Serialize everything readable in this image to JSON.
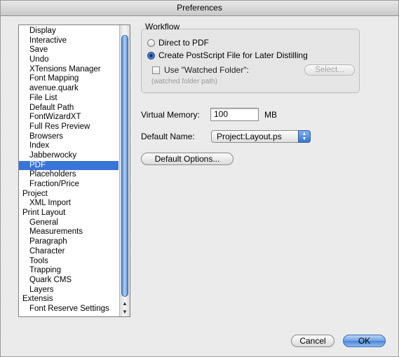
{
  "window": {
    "title": "Preferences"
  },
  "sidebar": {
    "items": [
      {
        "label": "Display",
        "level": 1,
        "selected": false
      },
      {
        "label": "Interactive",
        "level": 1,
        "selected": false
      },
      {
        "label": "Save",
        "level": 1,
        "selected": false
      },
      {
        "label": "Undo",
        "level": 1,
        "selected": false
      },
      {
        "label": "XTensions Manager",
        "level": 1,
        "selected": false
      },
      {
        "label": "Font Mapping",
        "level": 1,
        "selected": false
      },
      {
        "label": "avenue.quark",
        "level": 1,
        "selected": false
      },
      {
        "label": "File List",
        "level": 1,
        "selected": false
      },
      {
        "label": "Default Path",
        "level": 1,
        "selected": false
      },
      {
        "label": "FontWizardXT",
        "level": 1,
        "selected": false
      },
      {
        "label": "Full Res Preview",
        "level": 1,
        "selected": false
      },
      {
        "label": "Browsers",
        "level": 1,
        "selected": false
      },
      {
        "label": "Index",
        "level": 1,
        "selected": false
      },
      {
        "label": "Jabberwocky",
        "level": 1,
        "selected": false
      },
      {
        "label": "PDF",
        "level": 1,
        "selected": true
      },
      {
        "label": "Placeholders",
        "level": 1,
        "selected": false
      },
      {
        "label": "Fraction/Price",
        "level": 1,
        "selected": false
      },
      {
        "label": "Project",
        "level": 0,
        "selected": false
      },
      {
        "label": "XML Import",
        "level": 1,
        "selected": false
      },
      {
        "label": "Print Layout",
        "level": 0,
        "selected": false
      },
      {
        "label": "General",
        "level": 1,
        "selected": false
      },
      {
        "label": "Measurements",
        "level": 1,
        "selected": false
      },
      {
        "label": "Paragraph",
        "level": 1,
        "selected": false
      },
      {
        "label": "Character",
        "level": 1,
        "selected": false
      },
      {
        "label": "Tools",
        "level": 1,
        "selected": false
      },
      {
        "label": "Trapping",
        "level": 1,
        "selected": false
      },
      {
        "label": "Quark CMS",
        "level": 1,
        "selected": false
      },
      {
        "label": "Layers",
        "level": 1,
        "selected": false
      },
      {
        "label": "Extensis",
        "level": 0,
        "selected": false
      },
      {
        "label": "Font Reserve Settings",
        "level": 1,
        "selected": false
      }
    ]
  },
  "workflow": {
    "label": "Workflow",
    "direct_pdf": "Direct to PDF",
    "postscript": "Create PostScript File for Later Distilling",
    "selected_option": "postscript",
    "watched_folder_label": "Use \"Watched Folder\":",
    "watched_folder_checked": false,
    "select_button": "Select...",
    "path_hint": "(watched folder path)"
  },
  "virtual_memory": {
    "label": "Virtual Memory:",
    "value": "100",
    "unit": "MB"
  },
  "default_name": {
    "label": "Default Name:",
    "value": "Project:Layout.ps"
  },
  "buttons": {
    "default_options": "Default Options...",
    "cancel": "Cancel",
    "ok": "OK"
  },
  "icons": {
    "popup_arrows": "up-down-arrows-icon",
    "scroll_up": "triangle-up-icon",
    "scroll_down": "triangle-down-icon",
    "radio": "radio-button-icon",
    "checkbox": "checkbox-icon"
  },
  "colors": {
    "selection": "#3875d7",
    "accent": "#4a85d8"
  }
}
